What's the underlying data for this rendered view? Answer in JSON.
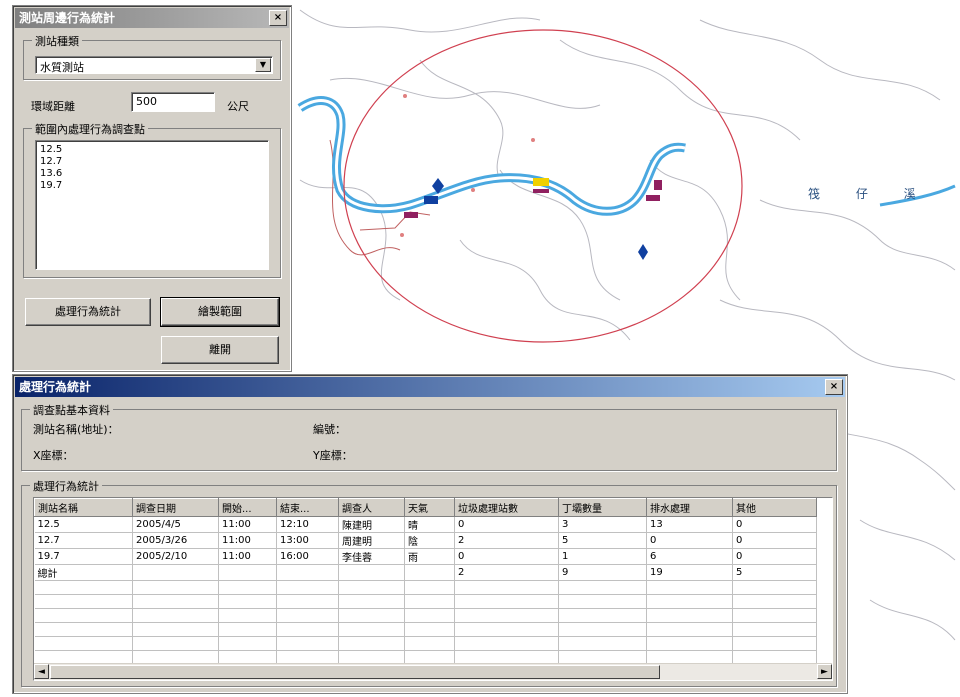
{
  "map": {
    "river_label": "筏 仔 溪"
  },
  "colors": {
    "river": "#4aa8e0",
    "buffer_circle": "#d04050",
    "station_marker": "#1040a0",
    "title_active": "#0a246a",
    "title_inactive": "#808080"
  },
  "query_window": {
    "title": "測站周邊行為統計",
    "close_label": "×",
    "station_group_title": "測站種類",
    "station_type_value": "水質測站",
    "buffer_label": "環域距離",
    "buffer_value": "500",
    "buffer_unit": "公尺",
    "list_group_title": "範圍內處理行為調查點",
    "list_items": [
      "12.5",
      "12.7",
      "13.6",
      "19.7"
    ],
    "stat_button": "處理行為統計",
    "draw_button": "繪製範圍",
    "exit_button": "離開"
  },
  "stats_window": {
    "title": "處理行為統計",
    "close_label": "×",
    "info_group_title": "調查點基本資料",
    "station_name_label": "測站名稱(地址)：",
    "number_label": "編號：",
    "x_label": "X座標：",
    "y_label": "Y座標：",
    "stat_group_title": "處理行為統計",
    "columns": [
      "測站名稱",
      "調查日期",
      "開始...",
      "結束...",
      "調查人",
      "天氣",
      "垃圾處理站數",
      "丁壩數量",
      "排水處理",
      "其他"
    ],
    "rows": [
      [
        "12.5",
        "2005/4/5",
        "11:00",
        "12:10",
        "陳建明",
        "晴",
        "0",
        "3",
        "13",
        "0"
      ],
      [
        "12.7",
        "2005/3/26",
        "11:00",
        "13:00",
        "周建明",
        "陰",
        "2",
        "5",
        "0",
        "0"
      ],
      [
        "19.7",
        "2005/2/10",
        "11:00",
        "16:00",
        "李佳蓉",
        "雨",
        "0",
        "1",
        "6",
        "0"
      ],
      [
        "總計",
        "",
        "",
        "",
        "",
        "",
        "2",
        "9",
        "19",
        "5"
      ]
    ],
    "scroll_left": "◄",
    "scroll_right": "►"
  }
}
